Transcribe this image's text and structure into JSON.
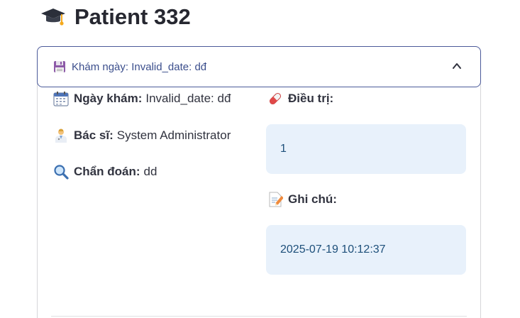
{
  "page": {
    "title": "Patient 332",
    "title_icon": "graduation-cap-icon"
  },
  "expander": {
    "header_icon": "floppy-disk-icon",
    "header_label": "Khám ngày: Invalid_date: dđ",
    "state": "expanded"
  },
  "left": {
    "exam_date": {
      "icon": "calendar-icon",
      "label": "Ngày khám:",
      "value": "Invalid_date: dđ"
    },
    "doctor": {
      "icon": "doctor-icon",
      "label": "Bác sĩ:",
      "value": "System Administrator"
    },
    "diagnosis": {
      "icon": "magnifier-icon",
      "label": "Chẩn đoán:",
      "value": "dd"
    }
  },
  "right": {
    "treatment": {
      "icon": "pill-icon",
      "label": "Điều trị:",
      "value": "1"
    },
    "notes": {
      "icon": "memo-icon",
      "label": "Ghi chú:",
      "value": "2025-07-19 10:12:37"
    }
  },
  "colors": {
    "info_box_bg": "#e8f1fb",
    "info_box_text": "#1d4f7a",
    "header_border": "#4b5a9a"
  }
}
